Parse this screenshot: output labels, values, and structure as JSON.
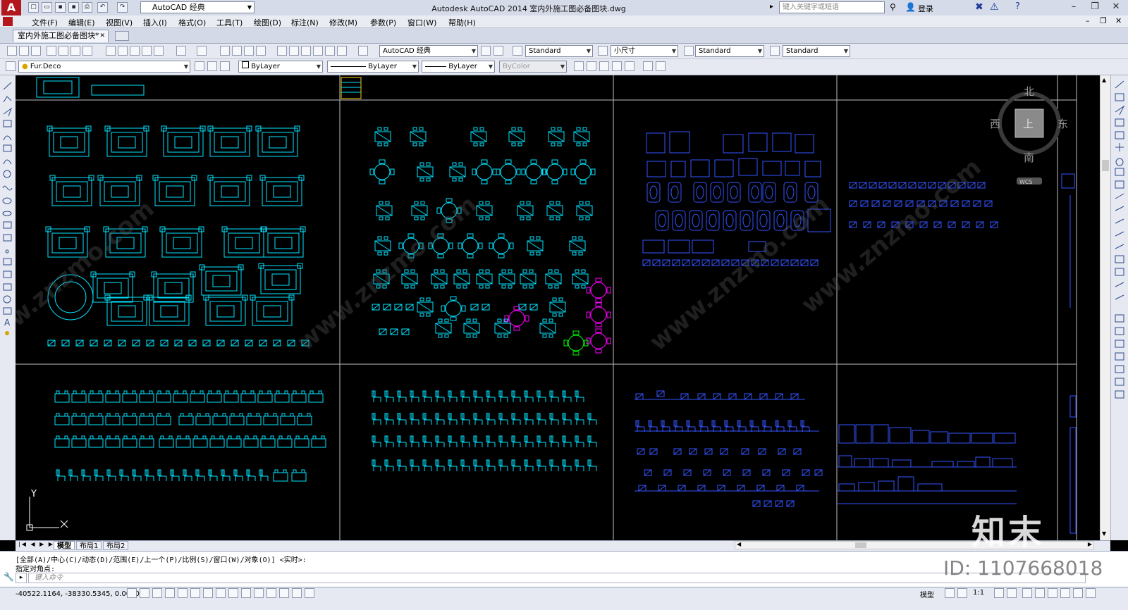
{
  "app": {
    "logo": "A",
    "workspace": "AutoCAD 经典",
    "title": "Autodesk AutoCAD 2014    室内外施工图必备图块.dwg",
    "search_placeholder": "键入关键字或短语",
    "login": "登录"
  },
  "menu": [
    "文件(F)",
    "编辑(E)",
    "视图(V)",
    "插入(I)",
    "格式(O)",
    "工具(T)",
    "绘图(D)",
    "标注(N)",
    "修改(M)",
    "参数(P)",
    "窗口(W)",
    "帮助(H)"
  ],
  "doc_tab": "室内外施工图必备图块*",
  "toolbar": {
    "workspace": "AutoCAD 经典",
    "text_style": "Standard",
    "dim_style": "小尺寸",
    "table_style": "Standard",
    "mleader_style": "Standard"
  },
  "props": {
    "layer": "Fur.Deco",
    "color": "ByLayer",
    "linetype": "ByLayer",
    "lineweight": "ByLayer",
    "plotstyle": "ByColor"
  },
  "viewcube": {
    "north": "北",
    "south": "南",
    "east": "东",
    "west": "西",
    "top": "上",
    "wcs": "WCS"
  },
  "ucs": {
    "y": "Y"
  },
  "layout_tabs": [
    "模型",
    "布局1",
    "布局2"
  ],
  "command": {
    "line1": "[全部(A)/中心(C)/动态(D)/范围(E)/上一个(P)/比例(S)/窗口(W)/对象(O)] <实时>:",
    "line2": "指定对角点:",
    "placeholder": "键入命令"
  },
  "status": {
    "coords": "-40522.1164, -38330.5345, 0.0000",
    "model": "模型",
    "scale": "1:1"
  },
  "watermark": {
    "logo": "知末",
    "id": "ID: 1107668018",
    "site": "www.znzmo.com"
  },
  "colors": {
    "cyan": "#00e5ff",
    "blue": "#3355ff",
    "magenta": "#ff00ff",
    "green": "#00ff00",
    "grid": "#bfbfbf"
  }
}
